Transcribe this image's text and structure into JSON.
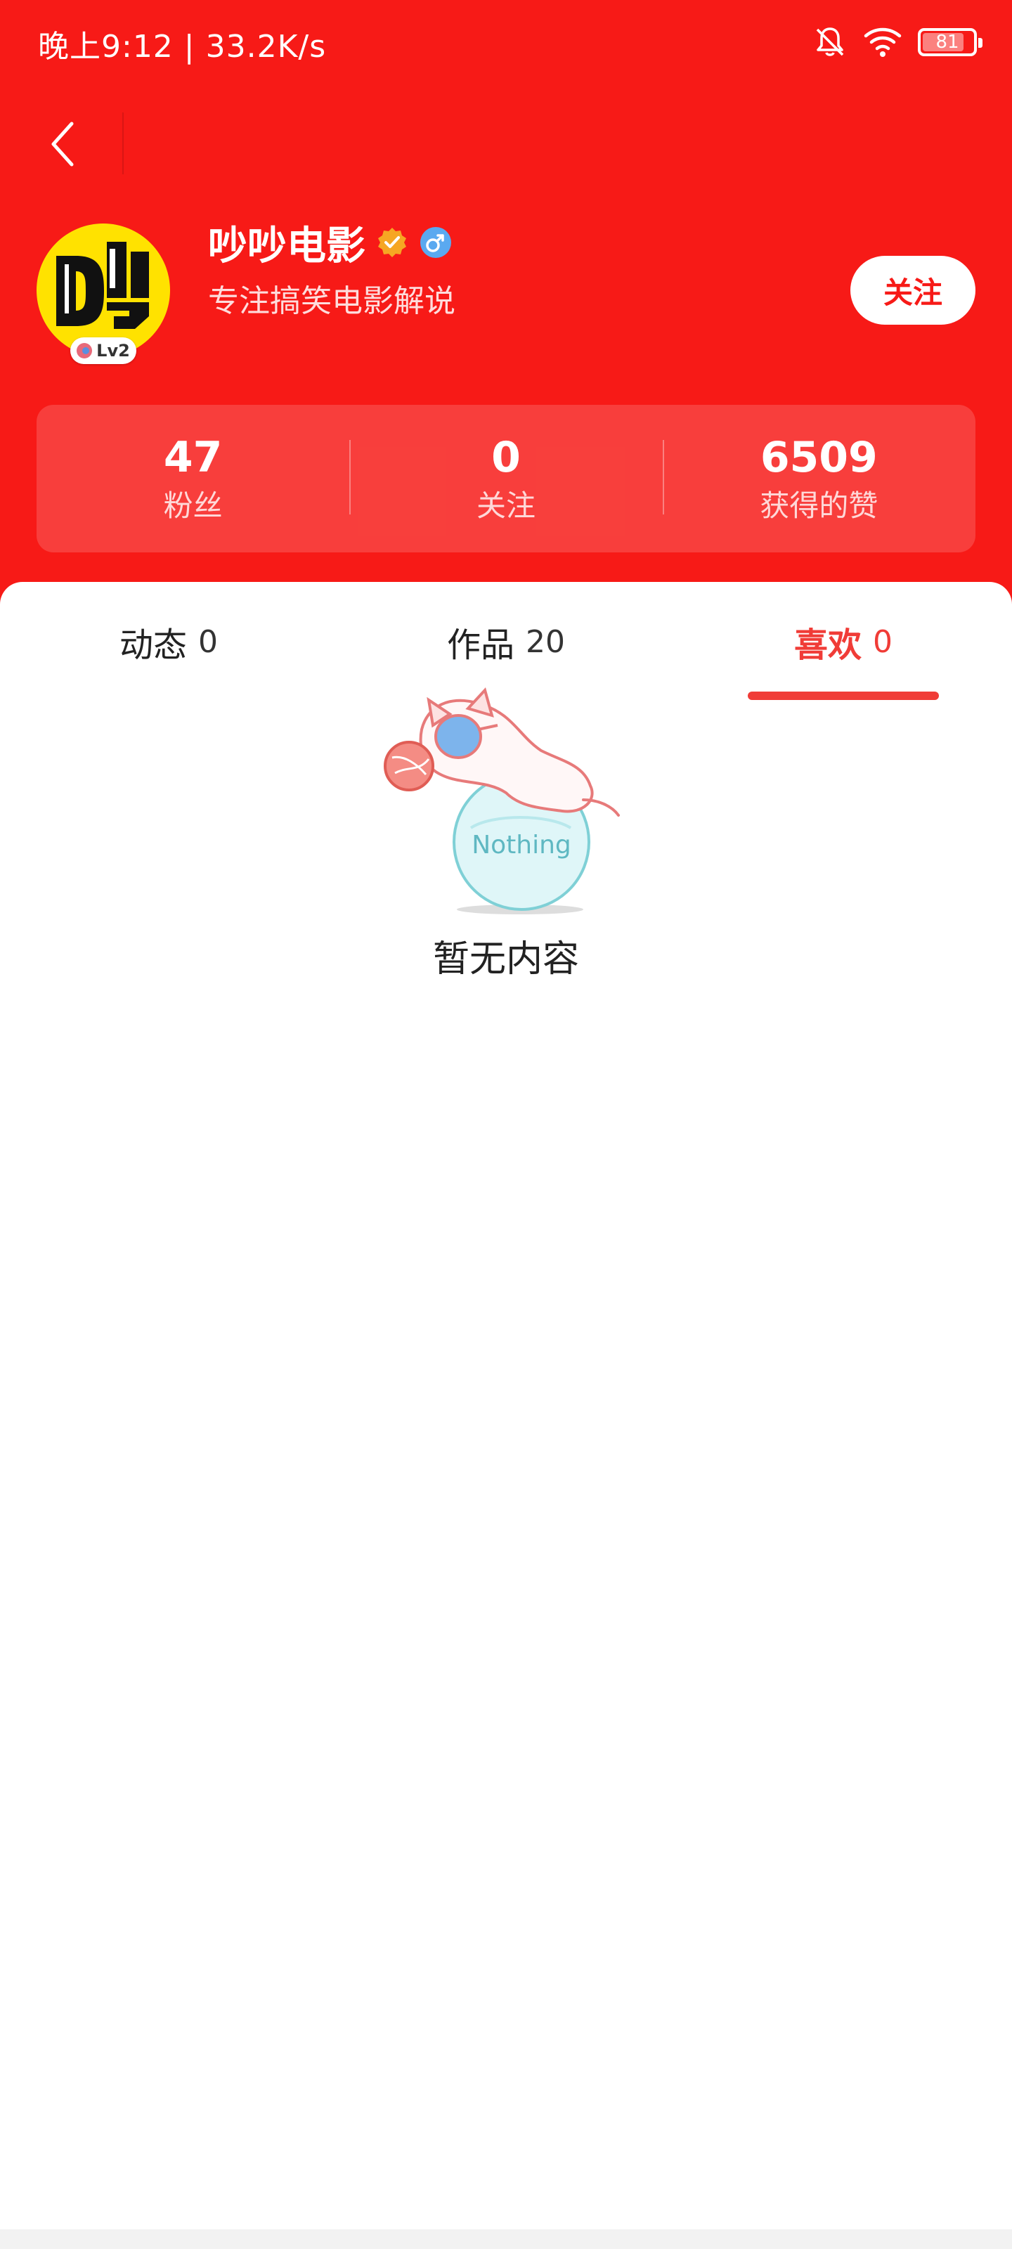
{
  "status_bar": {
    "time_speed": "晚上9:12 | 33.2K/s",
    "battery": "81",
    "battery_level": 0.81,
    "icons": [
      "mute-bell-icon",
      "wifi-icon",
      "battery-icon"
    ]
  },
  "nav": {
    "back_icon": "chevron-left-icon"
  },
  "profile": {
    "name": "吵吵电影",
    "bio": "专注搞笑电影解说",
    "level": "Lv2",
    "follow_label": "关注",
    "gender": "♂",
    "colors": {
      "header_bg": "#f71a17",
      "accent": "#f03c37"
    }
  },
  "stats": [
    {
      "value": "47",
      "label": "粉丝"
    },
    {
      "value": "0",
      "label": "关注"
    },
    {
      "value": "6509",
      "label": "获得的赞"
    }
  ],
  "tabs": [
    {
      "label": "动态",
      "count": "0",
      "active": false
    },
    {
      "label": "作品",
      "count": "20",
      "active": false
    },
    {
      "label": "喜欢",
      "count": "0",
      "active": true
    }
  ],
  "empty": {
    "ball_text": "Nothing",
    "message": "暂无内容"
  }
}
